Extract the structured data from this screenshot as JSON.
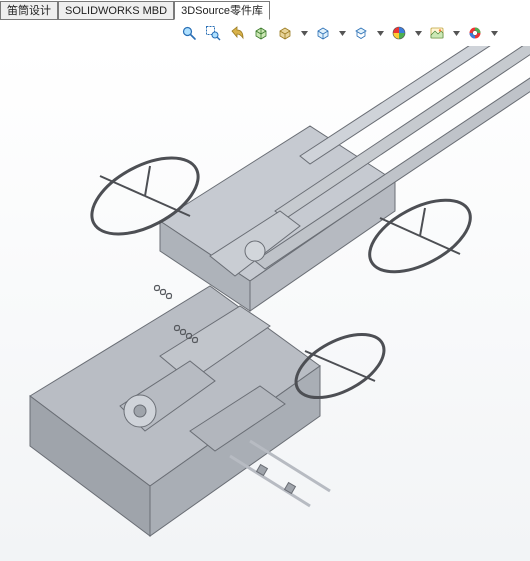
{
  "tabs": [
    {
      "label": "笛筒设计",
      "active": false
    },
    {
      "label": "SOLIDWORKS MBD",
      "active": false
    },
    {
      "label": "3DSource零件库",
      "active": true
    }
  ],
  "toolbar": {
    "icons": [
      {
        "name": "zoom-to-fit-icon"
      },
      {
        "name": "zoom-area-icon"
      },
      {
        "name": "previous-view-icon"
      },
      {
        "name": "section-view-icon"
      },
      {
        "name": "view-orientation-icon",
        "drop": true
      },
      {
        "name": "display-style-icon",
        "drop": true
      },
      {
        "name": "hide-show-icon",
        "drop": true
      },
      {
        "name": "edit-appearance-icon",
        "drop": true
      },
      {
        "name": "apply-scene-icon",
        "drop": true
      },
      {
        "name": "view-settings-icon",
        "drop": true
      }
    ]
  }
}
